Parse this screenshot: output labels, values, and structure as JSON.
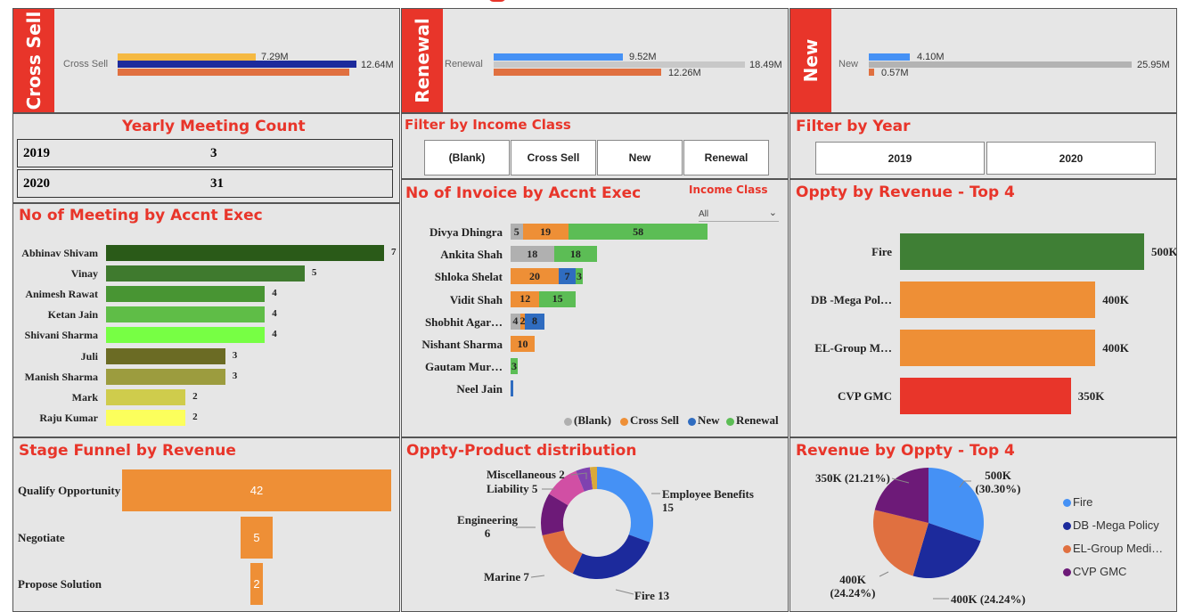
{
  "kpi": {
    "cross_sell": {
      "banner": "Cross Sell",
      "category": "Cross Sell",
      "v1": "7.29M",
      "v2": "12.64M"
    },
    "renewal": {
      "banner": "Renewal",
      "category": "Renewal",
      "v1": "9.52M",
      "v2": "18.49M",
      "v3": "12.26M"
    },
    "new": {
      "banner": "New",
      "category": "New",
      "v1": "4.10M",
      "v2": "25.95M",
      "v3": "0.57M"
    }
  },
  "yearly_meeting": {
    "title": "Yearly Meeting Count",
    "rows": [
      {
        "year": "2019",
        "count": "3"
      },
      {
        "year": "2020",
        "count": "31"
      }
    ]
  },
  "filter_income": {
    "title": "Filter by Income Class",
    "options": [
      "(Blank)",
      "Cross Sell",
      "New",
      "Renewal"
    ]
  },
  "filter_year": {
    "title": "Filter by Year",
    "options": [
      "2019",
      "2020"
    ]
  },
  "meetings_by_exec": {
    "title": "No of Meeting by Accnt Exec",
    "names": [
      "Abhinav Shivam",
      "Vinay",
      "Animesh Rawat",
      "Ketan Jain",
      "Shivani Sharma",
      "Juli",
      "Manish Sharma",
      "Mark",
      "Raju Kumar"
    ],
    "values": [
      7,
      5,
      4,
      4,
      4,
      3,
      3,
      2,
      2
    ],
    "colors": [
      "#2a5a18",
      "#3f7a2e",
      "#489533",
      "#5fbd47",
      "#77ff44",
      "#6b6b24",
      "#9c9c3e",
      "#cfcc4c",
      "#fcff5c"
    ]
  },
  "invoice_by_exec": {
    "title": "No of Invoice by Accnt Exec",
    "filter_label": "Income Class",
    "filter_value": "All",
    "names": [
      "Divya Dhingra",
      "Ankita Shah",
      "Shloka Shelat",
      "Vidit Shah",
      "Shobhit Agar…",
      "Nishant Sharma",
      "Gautam Mur…",
      "Neel Jain"
    ],
    "series": [
      {
        "name": "(Blank)",
        "color": "#b0b0b0",
        "values": [
          5,
          18,
          0,
          0,
          4,
          0,
          0,
          0
        ]
      },
      {
        "name": "Cross Sell",
        "color": "#ee8f36",
        "values": [
          19,
          0,
          20,
          12,
          2,
          10,
          0,
          0
        ]
      },
      {
        "name": "New",
        "color": "#2f6cc0",
        "values": [
          0,
          0,
          7,
          0,
          8,
          0,
          0,
          1
        ]
      },
      {
        "name": "Renewal",
        "color": "#5cbd55",
        "values": [
          58,
          18,
          3,
          15,
          0,
          0,
          3,
          0
        ]
      }
    ],
    "segment_labels": [
      [
        "5",
        "19",
        "",
        "58"
      ],
      [
        "18",
        "",
        "",
        "18"
      ],
      [
        "",
        "20",
        "7",
        "3"
      ],
      [
        "",
        "12",
        "",
        "15"
      ],
      [
        "4",
        "2",
        "8",
        ""
      ],
      [
        "",
        "10",
        "",
        ""
      ],
      [
        "",
        "",
        "",
        "3"
      ],
      [
        "",
        "",
        "",
        ""
      ]
    ]
  },
  "oppty_top4": {
    "title": "Oppty by Revenue - Top 4",
    "names": [
      "Fire",
      "DB -Mega Pol…",
      "EL-Group M…",
      "CVP GMC"
    ],
    "labels": [
      "500K",
      "400K",
      "400K",
      "350K"
    ],
    "values": [
      500,
      400,
      400,
      350
    ],
    "colors": [
      "#3f7f35",
      "#ee8f36",
      "#ee8f36",
      "#e8352a"
    ]
  },
  "stage_funnel": {
    "title": "Stage Funnel by Revenue",
    "stages": [
      "Qualify Opportunity",
      "Negotiate",
      "Propose Solution"
    ],
    "labels": [
      "42",
      "5",
      "2"
    ],
    "values": [
      42,
      5,
      2
    ]
  },
  "product_dist": {
    "title": "Oppty-Product distribution",
    "slices": [
      {
        "label": "Employee Benefits 15",
        "value": 15,
        "color": "#4591f5"
      },
      {
        "label": "Fire 13",
        "value": 13,
        "color": "#1c2a9c"
      },
      {
        "label": "Marine 7",
        "value": 7,
        "color": "#e07040"
      },
      {
        "label": "Engineering 6",
        "value": 6,
        "color": "#6d1a78"
      },
      {
        "label": "Liability 5",
        "value": 5,
        "color": "#d14fa4"
      },
      {
        "label": "Miscellaneous 2",
        "value": 2,
        "color": "#7f42b0"
      },
      {
        "label": "",
        "value": 1,
        "color": "#d9a93a"
      }
    ]
  },
  "revenue_pie": {
    "title": "Revenue by Oppty - Top 4",
    "slices": [
      {
        "name": "Fire",
        "label": "500K (30.30%)",
        "value": 500,
        "color": "#4591f5"
      },
      {
        "name": "DB -Mega Policy",
        "label": "400K (24.24%)",
        "value": 400,
        "color": "#1c2a9c"
      },
      {
        "name": "EL-Group Medi…",
        "label": "400K (24.24%)",
        "value": 400,
        "color": "#e07040"
      },
      {
        "name": "CVP GMC",
        "label": "350K (21.21%)",
        "value": 350,
        "color": "#6d1a78"
      }
    ]
  },
  "chart_data": [
    {
      "type": "bar",
      "title": "No of Meeting by Accnt Exec",
      "categories": [
        "Abhinav Shivam",
        "Vinay",
        "Animesh Rawat",
        "Ketan Jain",
        "Shivani Sharma",
        "Juli",
        "Manish Sharma",
        "Mark",
        "Raju Kumar"
      ],
      "values": [
        7,
        5,
        4,
        4,
        4,
        3,
        3,
        2,
        2
      ]
    },
    {
      "type": "bar",
      "title": "No of Invoice by Accnt Exec",
      "categories": [
        "Divya Dhingra",
        "Ankita Shah",
        "Shloka Shelat",
        "Vidit Shah",
        "Shobhit Agar…",
        "Nishant Sharma",
        "Gautam Mur…",
        "Neel Jain"
      ],
      "series": [
        {
          "name": "(Blank)",
          "values": [
            5,
            18,
            0,
            0,
            4,
            0,
            0,
            0
          ]
        },
        {
          "name": "Cross Sell",
          "values": [
            19,
            0,
            20,
            12,
            2,
            10,
            0,
            0
          ]
        },
        {
          "name": "New",
          "values": [
            0,
            0,
            7,
            0,
            8,
            0,
            0,
            1
          ]
        },
        {
          "name": "Renewal",
          "values": [
            58,
            18,
            3,
            15,
            0,
            0,
            3,
            0
          ]
        }
      ]
    },
    {
      "type": "bar",
      "title": "Oppty by Revenue - Top 4",
      "categories": [
        "Fire",
        "DB -Mega Pol…",
        "EL-Group M…",
        "CVP GMC"
      ],
      "values": [
        500,
        400,
        400,
        350
      ]
    },
    {
      "type": "bar",
      "title": "Stage Funnel by Revenue",
      "categories": [
        "Qualify Opportunity",
        "Negotiate",
        "Propose Solution"
      ],
      "values": [
        42,
        5,
        2
      ]
    },
    {
      "type": "pie",
      "title": "Oppty-Product distribution",
      "categories": [
        "Employee Benefits",
        "Fire",
        "Marine",
        "Engineering",
        "Liability",
        "Miscellaneous"
      ],
      "values": [
        15,
        13,
        7,
        6,
        5,
        2
      ]
    },
    {
      "type": "pie",
      "title": "Revenue by Oppty - Top 4",
      "categories": [
        "Fire",
        "DB -Mega Policy",
        "EL-Group Medi…",
        "CVP GMC"
      ],
      "values": [
        500,
        400,
        400,
        350
      ]
    }
  ]
}
